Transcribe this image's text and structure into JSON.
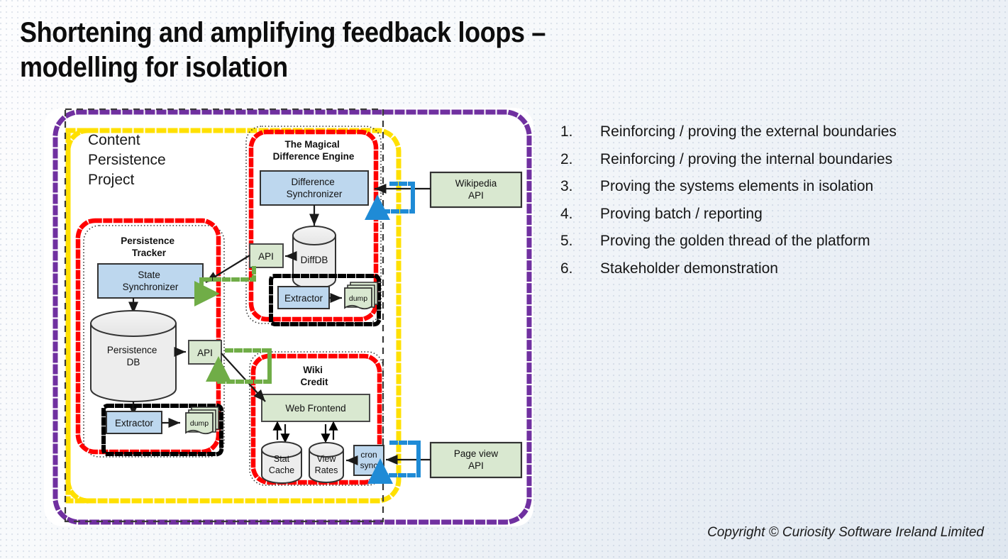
{
  "slide": {
    "title": "Shortening and amplifying feedback loops –\nmodelling for isolation",
    "footer": "Copyright © Curiosity Software Ireland Limited"
  },
  "list": {
    "items": [
      {
        "num": "1.",
        "text": "Reinforcing / proving  the external boundaries"
      },
      {
        "num": "2.",
        "text": "Reinforcing / proving  the internal boundaries"
      },
      {
        "num": "3.",
        "text": "Proving the systems elements in isolation"
      },
      {
        "num": "4.",
        "text": "Proving batch / reporting"
      },
      {
        "num": "5.",
        "text": "Proving the golden thread of the platform"
      },
      {
        "num": "6.",
        "text": "Stakeholder demonstration"
      }
    ]
  },
  "diagram": {
    "project_label": "Content\nPersistence\nProject",
    "groups": {
      "difference_engine": "The Magical\nDifference Engine",
      "persistence_tracker": "Persistence\nTracker",
      "wiki_credit": "Wiki\nCredit"
    },
    "nodes": {
      "difference_synchronizer": "Difference\nSynchronizer",
      "diffdb": "DiffDB",
      "api_diff": "API",
      "extractor_diff": "Extractor",
      "dump_diff": "dump",
      "state_synchronizer": "State\nSynchronizer",
      "persistence_db": "Persistence\nDB",
      "api_persistence": "API",
      "extractor_persistence": "Extractor",
      "dump_persistence": "dump",
      "web_frontend": "Web Frontend",
      "stat_cache": "Stat\nCache",
      "view_rates": "View\nRates",
      "cron_sync": "cron\nsync",
      "wikipedia_api": "Wikipedia\nAPI",
      "page_view_api": "Page view\nAPI"
    },
    "colors": {
      "outer_boundary": "#7030a0",
      "system_boundary": "#ffe000",
      "component_boundary": "#ff0000",
      "internal_link": "#70ad47",
      "external_link": "#1f8bd6",
      "batch_boundary": "#000000",
      "process_fill": "#bdd7ee",
      "api_fill": "#d9e8d0",
      "store_fill": "#ededed"
    }
  }
}
